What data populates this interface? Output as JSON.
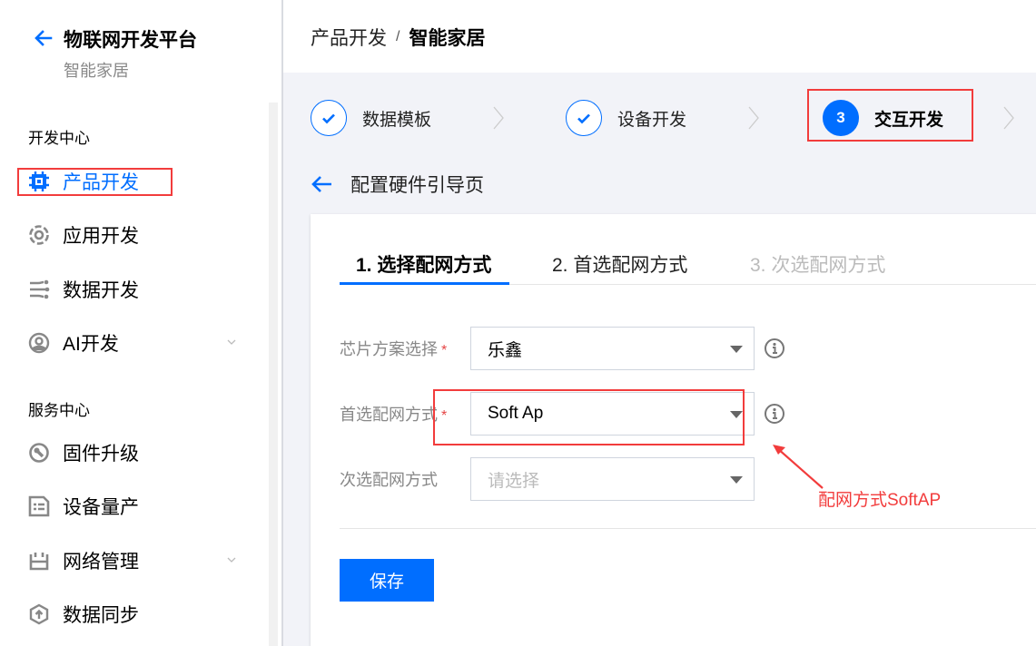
{
  "sidebar": {
    "title": "物联网开发平台",
    "subtitle": "智能家居",
    "groups": [
      {
        "label": "开发中心"
      },
      {
        "label": "服务中心"
      }
    ],
    "items": [
      {
        "label": "产品开发",
        "icon": "chip-icon",
        "active": true
      },
      {
        "label": "应用开发",
        "icon": "app-ring-icon"
      },
      {
        "label": "数据开发",
        "icon": "data-flow-icon"
      },
      {
        "label": "AI开发",
        "icon": "ai-icon",
        "expandable": true
      },
      {
        "label": "固件升级",
        "icon": "firmware-icon"
      },
      {
        "label": "设备量产",
        "icon": "mass-production-icon"
      },
      {
        "label": "网络管理",
        "icon": "network-icon",
        "expandable": true
      },
      {
        "label": "数据同步",
        "icon": "data-sync-icon"
      }
    ]
  },
  "breadcrumb": {
    "parent": "产品开发",
    "separator": "/",
    "current": "智能家居"
  },
  "steps": [
    {
      "label": "数据模板",
      "status": "done"
    },
    {
      "label": "设备开发",
      "status": "done"
    },
    {
      "label": "交互开发",
      "status": "current",
      "number": "3"
    }
  ],
  "page": {
    "title": "配置硬件引导页"
  },
  "tabs": [
    {
      "label": "1. 选择配网方式",
      "state": "active"
    },
    {
      "label": "2. 首选配网方式",
      "state": "normal"
    },
    {
      "label": "3. 次选配网方式",
      "state": "disabled"
    }
  ],
  "form": {
    "chip": {
      "label": "芯片方案选择",
      "required": "*",
      "value": "乐鑫"
    },
    "primary": {
      "label": "首选配网方式",
      "required": "*",
      "value": "Soft Ap"
    },
    "secondary": {
      "label": "次选配网方式",
      "placeholder": "请选择"
    },
    "save_label": "保存"
  },
  "annotation": {
    "text": "配网方式SoftAP",
    "color": "#f23c3c"
  },
  "colors": {
    "accent": "#006eff",
    "highlight": "#f23c3c"
  }
}
